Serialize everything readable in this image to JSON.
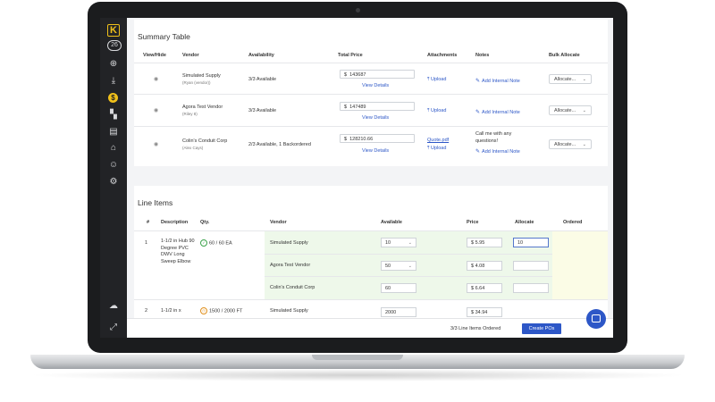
{
  "sidebar": {
    "logo": "K",
    "badge": "26",
    "items": [
      {
        "icon": "plus-circle-icon",
        "glyph": "⊕"
      },
      {
        "icon": "download-icon",
        "glyph": "⤓"
      },
      {
        "icon": "dollar-icon",
        "glyph": "$"
      },
      {
        "icon": "truck-icon",
        "glyph": "▚"
      },
      {
        "icon": "document-icon",
        "glyph": "▤"
      },
      {
        "icon": "warehouse-icon",
        "glyph": "⌂"
      },
      {
        "icon": "user-icon",
        "glyph": "☺"
      },
      {
        "icon": "gear-icon",
        "glyph": "⚙"
      }
    ],
    "bottom": [
      {
        "icon": "chat-bubbles-icon",
        "glyph": "☁"
      },
      {
        "icon": "expand-icon",
        "glyph": "⤢"
      }
    ]
  },
  "summary": {
    "title": "Summary Table",
    "columns": [
      "View/Hide",
      "Vendor",
      "Availability",
      "Total Price",
      "Attachments",
      "Notes",
      "Bulk Allocate"
    ],
    "rows": [
      {
        "vendor": "Simulated Supply",
        "contact": "(Ryan (vendor))",
        "availability": "3/3 Available",
        "currency": "$",
        "price": "143687",
        "view_details": "View Details",
        "attachment_file": "",
        "upload": "Upload",
        "note_text": "",
        "note_link": "Add Internal Note",
        "allocate": "Allocate..."
      },
      {
        "vendor": "Agora Test Vendor",
        "contact": "(Riley 8)",
        "availability": "3/3 Available",
        "currency": "$",
        "price": "147489",
        "view_details": "View Details",
        "attachment_file": "",
        "upload": "Upload",
        "note_text": "",
        "note_link": "Add Internal Note",
        "allocate": "Allocate..."
      },
      {
        "vendor": "Colin's Conduit Corp",
        "contact": "(Alex Cays)",
        "availability": "2/3 Available, 1 Backordered",
        "currency": "$",
        "price": "128210.66",
        "view_details": "View Details",
        "attachment_file": "Quote.pdf",
        "upload": "Upload",
        "note_text": "Call me with any questions!",
        "note_link": "Add Internal Note",
        "allocate": "Allocate..."
      }
    ]
  },
  "line_items": {
    "title": "Line Items",
    "columns": [
      "#",
      "Description",
      "Qty.",
      "Vendor",
      "Available",
      "Price",
      "Allocate",
      "Ordered"
    ],
    "items": [
      {
        "num": "1",
        "description": "1-1/2 in Hub 90 Degree PVC DWV Long Sweep Elbow",
        "qty": "60 / 60 EA",
        "qty_status": "complete",
        "vendors": [
          {
            "name": "Simulated Supply",
            "available": "10",
            "has_dropdown": true,
            "currency": "$",
            "price": "5.95",
            "allocate": "10"
          },
          {
            "name": "Agora Test Vendor",
            "available": "50",
            "has_dropdown": true,
            "currency": "$",
            "price": "4.08",
            "allocate": ""
          },
          {
            "name": "Colin's Conduit Corp",
            "available": "60",
            "has_dropdown": false,
            "currency": "$",
            "price": "6.64",
            "allocate": ""
          }
        ]
      },
      {
        "num": "2",
        "description": "1-1/2 in x",
        "qty": "1500 / 2000 FT",
        "qty_status": "partial",
        "vendors": [
          {
            "name": "Simulated Supply",
            "available": "2000",
            "has_dropdown": false,
            "currency": "$",
            "price": "34.94",
            "allocate": ""
          }
        ]
      }
    ]
  },
  "footer": {
    "status": "3/3 Line Items Ordered",
    "create_button": "Create POs"
  },
  "colors": {
    "accent": "#2d57c7",
    "sidebar": "#222326",
    "logo": "#f0c01a",
    "green_row": "#eef8ea",
    "yellow_col": "#fbfce6"
  }
}
